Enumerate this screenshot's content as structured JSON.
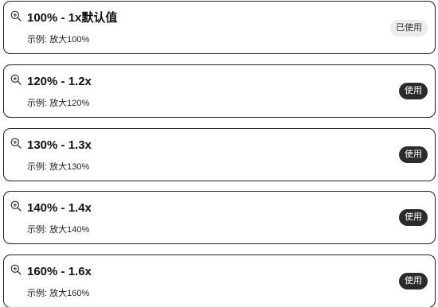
{
  "zoom_options": [
    {
      "title": "100% - 1x默认值",
      "example": "示例: 放大100%",
      "action": "已使用",
      "state": "used",
      "icon": "zoom-in-icon"
    },
    {
      "title": "120% - 1.2x",
      "example": "示例: 放大120%",
      "action": "使用",
      "state": "available",
      "icon": "zoom-in-icon"
    },
    {
      "title": "130% - 1.3x",
      "example": "示例: 放大130%",
      "action": "使用",
      "state": "available",
      "icon": "zoom-in-icon"
    },
    {
      "title": "140% - 1.4x",
      "example": "示例: 放大140%",
      "action": "使用",
      "state": "available",
      "icon": "zoom-in-icon"
    },
    {
      "title": "160% - 1.6x",
      "example": "示例: 放大160%",
      "action": "使用",
      "state": "available",
      "icon": "zoom-in-icon"
    }
  ],
  "colors": {
    "border": "#1f1f1f",
    "use_button_bg": "#2b2b2b",
    "used_button_bg": "#ececec"
  }
}
